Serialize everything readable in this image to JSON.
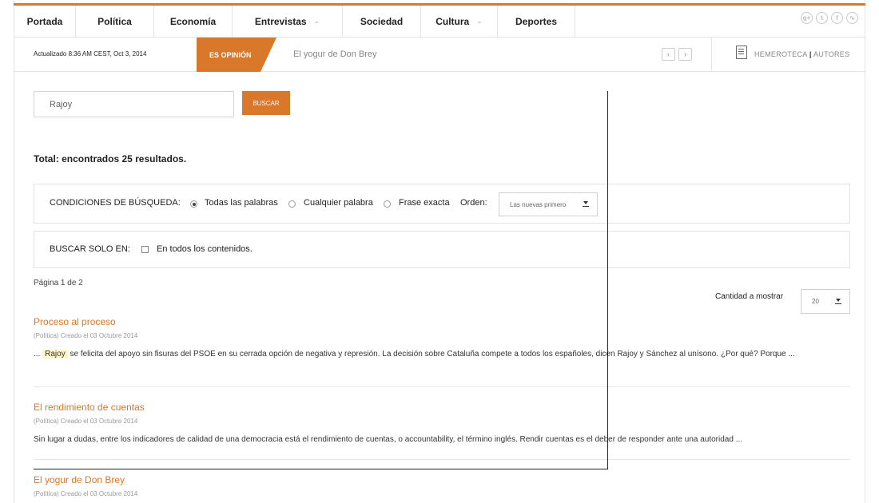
{
  "nav": {
    "items": [
      {
        "label": "Portada"
      },
      {
        "label": "Política"
      },
      {
        "label": "Economía"
      },
      {
        "label": "Entrevistas",
        "dropdown": true
      },
      {
        "label": "Sociedad"
      },
      {
        "label": "Cultura",
        "dropdown": true
      },
      {
        "label": "Deportes"
      }
    ],
    "social_icons": [
      "google-plus-icon",
      "twitter-icon",
      "facebook-icon",
      "rss-icon"
    ]
  },
  "ticker": {
    "updated": "Actualizado 8:36 AM CEST, Oct 3, 2014",
    "badge": "ES OPINIÓN",
    "headline": "El yogur de Don Brey",
    "hemeroteca": "HEMEROTECA",
    "separator": "|",
    "autores": "AUTORES"
  },
  "search": {
    "value": "Rajoy",
    "button": "BUSCAR"
  },
  "total": "Total: encontrados 25 resultados.",
  "conditions": {
    "label": "CONDICIONES DE BÚSQUEDA:",
    "options": [
      "Todas las palabras",
      "Cualquier palabra",
      "Frase exacta"
    ],
    "selected": "Todas las palabras",
    "order_label": "Orden:",
    "order_value": "Las nuevas primero"
  },
  "search_only": {
    "label": "BUSCAR SOLO EN:",
    "option": "En todos los contenidos."
  },
  "pagination": {
    "text": "Página 1 de 2",
    "count_label": "Cantidad a mostrar",
    "count_value": "20"
  },
  "results": [
    {
      "title": "Proceso al proceso",
      "meta": "(Política) Creado el 03 Octubre 2014",
      "prefix": "...",
      "highlight": "Rajoy",
      "snippet": "se felicita del apoyo sin fisuras del PSOE en su cerrada opción de negativa y represión. La decisión sobre Cataluña compete a todos los españoles, dicen Rajoy y Sánchez al unísono. ¿Por qué? Porque ..."
    },
    {
      "title": "El rendimiento de cuentas",
      "meta": "(Política) Creado el 03 Octubre 2014",
      "snippet": "Sin lugar a dudas, entre los indicadores de calidad de una democracia está el rendimiento de cuentas, o accountability, el término inglés. Rendir cuentas es el deber de responder ante una autoridad ..."
    },
    {
      "title": "El yogur de Don Brey",
      "meta": "(Política) Creado el 03 Octubre 2014"
    }
  ],
  "colors": {
    "accent": "#d9772a"
  }
}
